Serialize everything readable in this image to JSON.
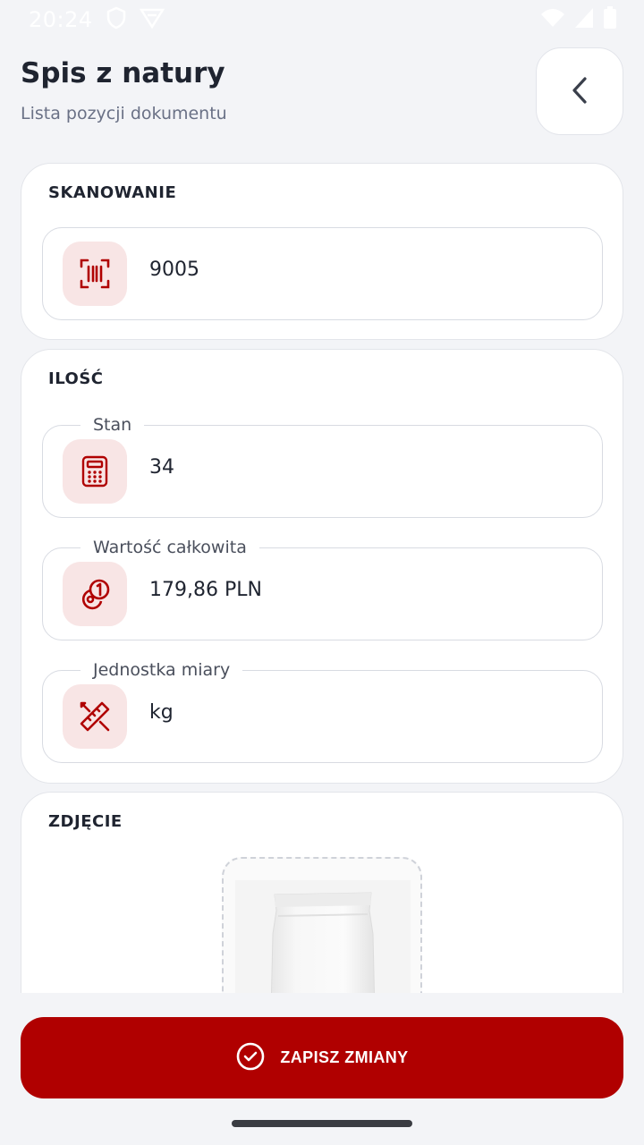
{
  "status_bar": {
    "time": "20:24",
    "icons": [
      "shield-icon",
      "vpn-icon",
      "wifi-icon",
      "signal-icon",
      "battery-icon"
    ]
  },
  "header": {
    "title": "Spis z natury",
    "subtitle": "Lista pozycji dokumentu",
    "back_icon": "chevron-left-icon"
  },
  "sections": {
    "scanning": {
      "title": "SKANOWANIE",
      "barcode_value": "9005",
      "icon": "barcode-scan-icon"
    },
    "quantity": {
      "title": "ILOŚĆ",
      "fields": [
        {
          "label": "Stan",
          "value": "34",
          "icon": "calculator-icon"
        },
        {
          "label": "Wartość całkowita",
          "value": "179,86 PLN",
          "icon": "coins-icon"
        },
        {
          "label": "Jednostka miary",
          "value": "kg",
          "icon": "ruler-pencil-icon"
        }
      ]
    },
    "photo": {
      "title": "ZDJĘCIE"
    }
  },
  "actions": {
    "save_label": "ZAPISZ ZMIANY",
    "save_icon": "check-circle-icon"
  },
  "colors": {
    "accent": "#b00000",
    "icon_bg": "#f8e5e5",
    "background": "#f3f4f7"
  }
}
